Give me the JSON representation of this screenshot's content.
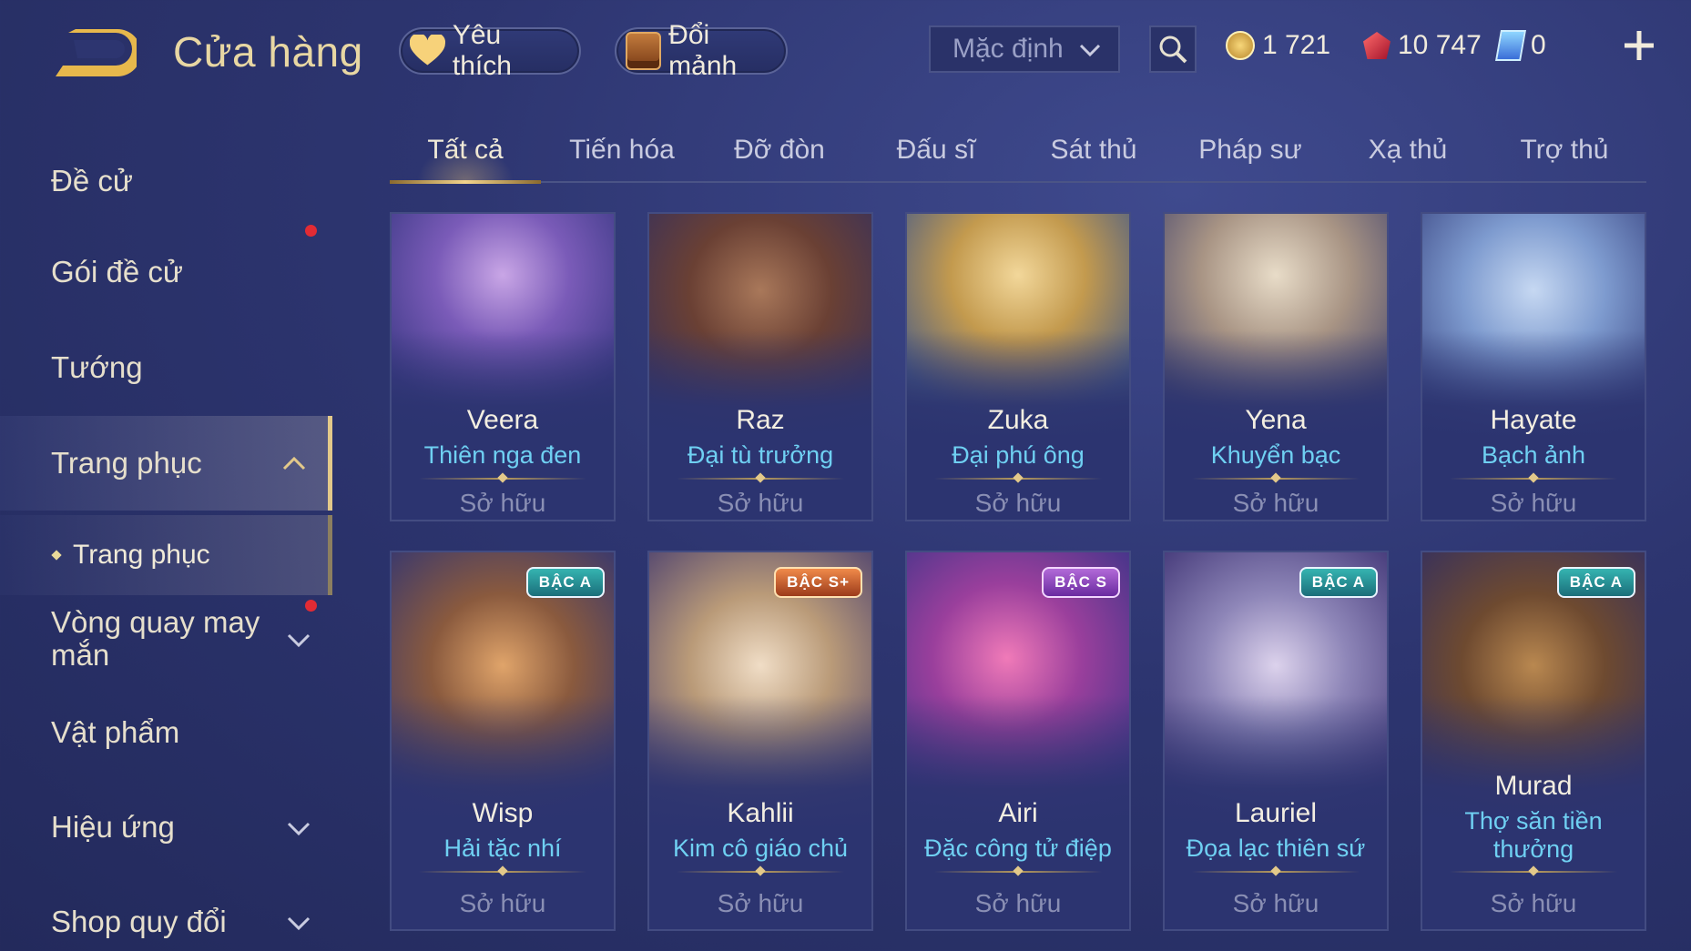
{
  "header": {
    "title": "Cửa hàng",
    "favorites_label": "Yêu thích",
    "exchange_label": "Đổi mảnh",
    "sort_selected": "Mặc định",
    "gold": "1 721",
    "rubies": "10 747",
    "vouchers": "0"
  },
  "sidebar": {
    "items": [
      {
        "label": "Đề cử"
      },
      {
        "label": "Gói đề cử"
      },
      {
        "label": "Tướng"
      },
      {
        "label": "Trang phục"
      },
      {
        "label": "Trang phục"
      },
      {
        "label": "Vòng quay may mắn"
      },
      {
        "label": "Vật phẩm"
      },
      {
        "label": "Hiệu ứng"
      },
      {
        "label": "Shop quy đổi"
      }
    ]
  },
  "tabs": [
    "Tất cả",
    "Tiến hóa",
    "Đỡ đòn",
    "Đấu sĩ",
    "Sát thủ",
    "Pháp sư",
    "Xạ thủ",
    "Trợ thủ"
  ],
  "cards": [
    {
      "hero": "Veera",
      "skin": "Thiên nga đen",
      "status": "Sở hữu",
      "badge": ""
    },
    {
      "hero": "Raz",
      "skin": "Đại tù trưởng",
      "status": "Sở hữu",
      "badge": ""
    },
    {
      "hero": "Zuka",
      "skin": "Đại phú ông",
      "status": "Sở hữu",
      "badge": ""
    },
    {
      "hero": "Yena",
      "skin": "Khuyển bạc",
      "status": "Sở hữu",
      "badge": ""
    },
    {
      "hero": "Hayate",
      "skin": "Bạch ảnh",
      "status": "Sở hữu",
      "badge": ""
    },
    {
      "hero": "Wisp",
      "skin": "Hải tặc nhí",
      "status": "Sở hữu",
      "badge": "BẬC A"
    },
    {
      "hero": "Kahlii",
      "skin": "Kim cô giáo chủ",
      "status": "Sở hữu",
      "badge": "BẬC S+"
    },
    {
      "hero": "Airi",
      "skin": "Đặc công tử điệp",
      "status": "Sở hữu",
      "badge": "BẬC S"
    },
    {
      "hero": "Lauriel",
      "skin": "Đọa lạc thiên sứ",
      "status": "Sở hữu",
      "badge": "BẬC A"
    },
    {
      "hero": "Murad",
      "skin": "Thợ săn tiền thưởng",
      "status": "Sở hữu",
      "badge": "BẬC A"
    }
  ],
  "colors": {
    "accent_gold": "#e3c98a",
    "skin_name": "#6fd0f2",
    "notification_dot": "#e22b34"
  }
}
